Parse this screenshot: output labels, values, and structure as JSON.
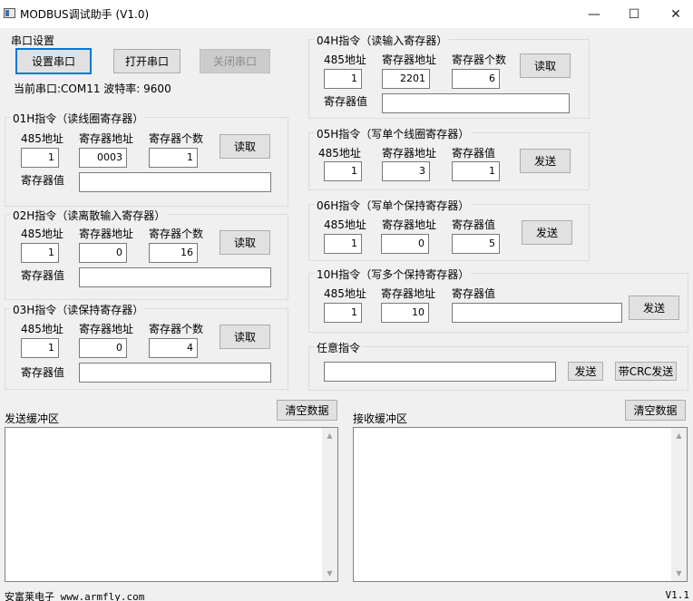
{
  "window": {
    "title": "MODBUS调试助手 (V1.0)",
    "minimize": "—",
    "maximize": "☐",
    "close": "✕"
  },
  "serial": {
    "group_title": "串口设置",
    "setup_button": "设置串口",
    "open_button": "打开串口",
    "close_button": "关闭串口",
    "status": "当前串口:COM11 波特率: 9600"
  },
  "cmd01": {
    "title": "01H指令（读线圈寄存器）",
    "addr_label": "485地址",
    "reg_label": "寄存器地址",
    "count_label": "寄存器个数",
    "value_label": "寄存器值",
    "addr": "1",
    "reg": "0003",
    "count": "1",
    "value": "",
    "button": "读取"
  },
  "cmd02": {
    "title": "02H指令（读离散输入寄存器）",
    "addr_label": "485地址",
    "reg_label": "寄存器地址",
    "count_label": "寄存器个数",
    "value_label": "寄存器值",
    "addr": "1",
    "reg": "0",
    "count": "16",
    "value": "",
    "button": "读取"
  },
  "cmd03": {
    "title": "03H指令（读保持寄存器）",
    "addr_label": "485地址",
    "reg_label": "寄存器地址",
    "count_label": "寄存器个数",
    "value_label": "寄存器值",
    "addr": "1",
    "reg": "0",
    "count": "4",
    "value": "",
    "button": "读取"
  },
  "cmd04": {
    "title": "04H指令（读输入寄存器）",
    "addr_label": "485地址",
    "reg_label": "寄存器地址",
    "count_label": "寄存器个数",
    "value_label": "寄存器值",
    "addr": "1",
    "reg": "2201",
    "count": "6",
    "value": "",
    "button": "读取"
  },
  "cmd05": {
    "title": "05H指令（写单个线圈寄存器）",
    "addr_label": "485地址",
    "reg_label": "寄存器地址",
    "value_label": "寄存器值",
    "addr": "1",
    "reg": "3",
    "value": "1",
    "button": "发送"
  },
  "cmd06": {
    "title": "06H指令（写单个保持寄存器）",
    "addr_label": "485地址",
    "reg_label": "寄存器地址",
    "value_label": "寄存器值",
    "addr": "1",
    "reg": "0",
    "value": "5",
    "button": "发送"
  },
  "cmd10": {
    "title": "10H指令（写多个保持寄存器）",
    "addr_label": "485地址",
    "reg_label": "寄存器地址",
    "value_label": "寄存器值",
    "addr": "1",
    "reg": "10",
    "value": "",
    "button": "发送"
  },
  "custom": {
    "title": "任意指令",
    "value": "",
    "send_button": "发送",
    "crc_button": "带CRC发送"
  },
  "send_buffer": {
    "label": "发送缓冲区",
    "clear_button": "清空数据",
    "content": ""
  },
  "recv_buffer": {
    "label": "接收缓冲区",
    "clear_button": "清空数据",
    "content": ""
  },
  "footer": {
    "company": "安富莱电子 www.armfly.com",
    "version": "V1.1"
  },
  "icons": {
    "app": "app-window-icon",
    "scroll_up": "▲",
    "scroll_down": "▼"
  }
}
